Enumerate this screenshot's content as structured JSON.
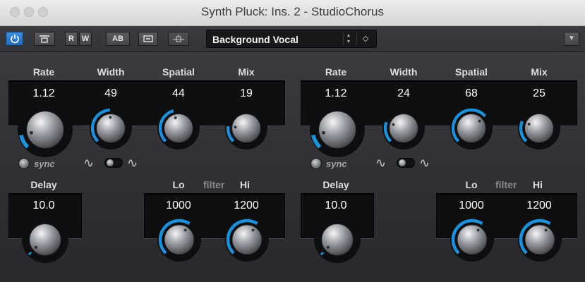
{
  "window": {
    "title": "Synth Pluck: Ins. 2 - StudioChorus"
  },
  "toolbar": {
    "read_label": "R",
    "write_label": "W",
    "ab_label": "AB",
    "preset_name": "Background Vocal"
  },
  "left": {
    "rate": {
      "label": "Rate",
      "value": "1.12"
    },
    "width": {
      "label": "Width",
      "value": "49"
    },
    "spatial": {
      "label": "Spatial",
      "value": "44"
    },
    "mix": {
      "label": "Mix",
      "value": "19"
    },
    "sync_label": "sync",
    "delay": {
      "label": "Delay",
      "value": "10.0"
    },
    "filter_label": "filter",
    "lo": {
      "label": "Lo",
      "value": "1000"
    },
    "hi": {
      "label": "Hi",
      "value": "1200"
    }
  },
  "right": {
    "rate": {
      "label": "Rate",
      "value": "1.12"
    },
    "width": {
      "label": "Width",
      "value": "24"
    },
    "spatial": {
      "label": "Spatial",
      "value": "68"
    },
    "mix": {
      "label": "Mix",
      "value": "25"
    },
    "sync_label": "sync",
    "delay": {
      "label": "Delay",
      "value": "10.0"
    },
    "filter_label": "filter",
    "lo": {
      "label": "Lo",
      "value": "1000"
    },
    "hi": {
      "label": "Hi",
      "value": "1200"
    }
  },
  "colors": {
    "accent": "#1f8fd8",
    "panel": "#2f3034",
    "display": "#0e0f10"
  }
}
